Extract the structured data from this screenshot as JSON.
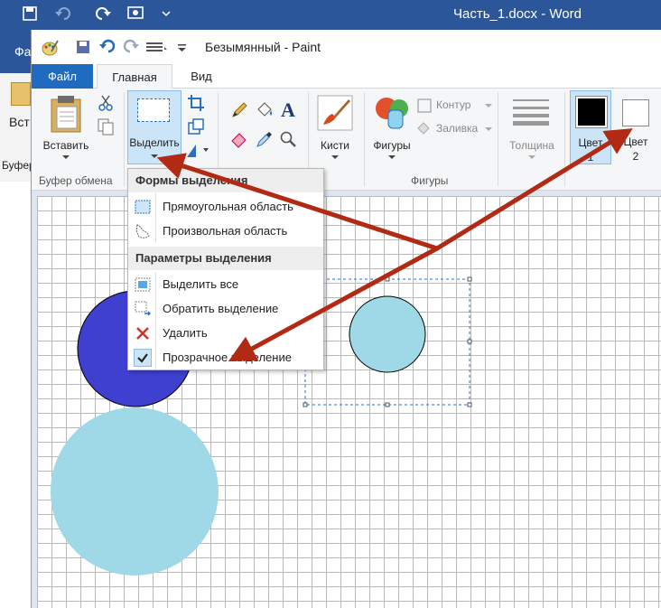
{
  "word": {
    "doc_title": "Часть_1.docx - Word",
    "file_tab_partial": "Фа",
    "paste_partial": "Вст",
    "clipboard_partial": "Буфер"
  },
  "paint": {
    "title": "Безымянный - Paint",
    "tabs": [
      "Файл",
      "Главная",
      "Вид"
    ],
    "ribbon": {
      "paste_label": "Вставить",
      "select_label": "Выделить",
      "brushes_label": "Кисти",
      "shapes_label": "Фигуры",
      "outline_label": "Контур",
      "fill_label": "Заливка",
      "size_label": "Толщина",
      "color1_label": "Цвет",
      "color1_sub": "1",
      "color2_label": "Цвет",
      "color2_sub": "2",
      "group_clipboard": "Буфер обмена",
      "group_shapes": "Фигуры"
    },
    "select_menu": {
      "header_shapes": "Формы выделения",
      "item_rect": "Прямоугольная область",
      "item_free": "Произвольная область",
      "header_params": "Параметры выделения",
      "item_select_all": "Выделить все",
      "item_invert": "Обратить выделение",
      "item_delete": "Удалить",
      "item_transparent": "Прозрачное выделение"
    }
  },
  "colors": {
    "accent_blue": "#1f6bc0",
    "word_blue": "#2b579a",
    "circle_dark_blue": "#3f3fd0",
    "circle_light_blue": "#9fd9e8",
    "arrow_red": "#b22a14"
  }
}
